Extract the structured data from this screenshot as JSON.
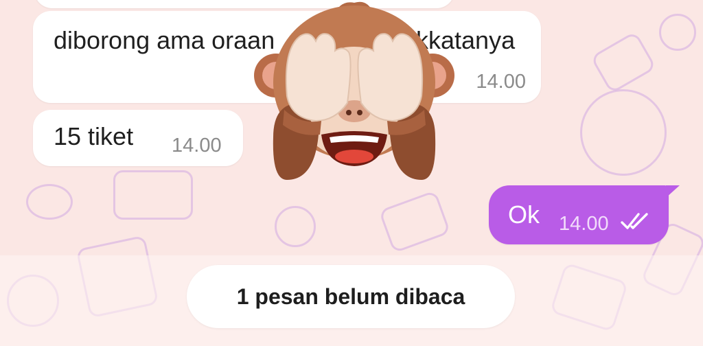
{
  "messages": [
    {
      "text": "diborong ama oraan",
      "text_right": "kkatanya",
      "time": "14.00"
    },
    {
      "text": "15 tiket",
      "time": "14.00"
    }
  ],
  "outgoing": {
    "text": "Ok",
    "time": "14.00",
    "status_icon": "double-check-icon"
  },
  "unread_banner": {
    "label": "1 pesan belum dibaca"
  },
  "sticker": {
    "icon": "see-no-evil-monkey-icon"
  },
  "colors": {
    "background": "#fbe7e4",
    "incoming_bubble": "#ffffff",
    "outgoing_bubble": "#b95ce7",
    "doodle": "#d2aae1"
  }
}
